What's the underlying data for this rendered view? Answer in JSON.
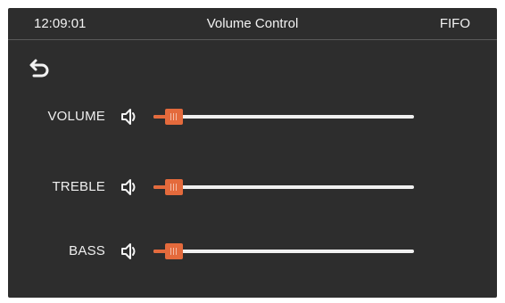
{
  "status_bar": {
    "time": "12:09:01",
    "title": "Volume Control",
    "mode": "FIFO"
  },
  "navigation": {
    "back_icon": "back-arrow-icon"
  },
  "colors": {
    "background": "#2d2d2d",
    "accent": "#e46a3c",
    "text": "#f2f2f2",
    "track": "#f0f0f0"
  },
  "controls": [
    {
      "label": "VOLUME",
      "icon": "speaker-icon",
      "level": 0.08
    },
    {
      "label": "TREBLE",
      "icon": "speaker-icon",
      "level": 0.08
    },
    {
      "label": "BASS",
      "icon": "speaker-icon",
      "level": 0.08
    }
  ]
}
